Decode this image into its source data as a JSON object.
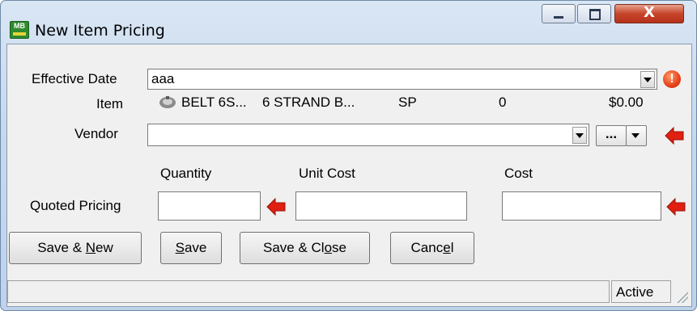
{
  "window": {
    "title": "New Item Pricing",
    "app_icon_text": "MB",
    "close_glyph": "X"
  },
  "form": {
    "effective_date": {
      "label": "Effective Date",
      "value": "aaa"
    },
    "item": {
      "label": "Item",
      "code": "BELT 6S...",
      "description": "6 STRAND B...",
      "unit": "SP",
      "quantity": "0",
      "price": "$0.00"
    },
    "vendor": {
      "label": "Vendor",
      "value": "",
      "ellipsis_label": "..."
    },
    "pricing": {
      "row_label": "Quoted Pricing",
      "quantity_header": "Quantity",
      "unit_cost_header": "Unit Cost",
      "cost_header": "Cost",
      "quantity_value": "",
      "unit_cost_value": "",
      "cost_value": ""
    }
  },
  "buttons": {
    "save_new": {
      "pre": "Save & ",
      "key": "N",
      "post": "ew"
    },
    "save": {
      "pre": "",
      "key": "S",
      "post": "ave"
    },
    "save_close": {
      "pre": "Save & Cl",
      "key": "o",
      "post": "se"
    },
    "cancel": {
      "pre": "Canc",
      "key": "e",
      "post": "l"
    }
  },
  "statusbar": {
    "status": "Active"
  },
  "icons": {
    "error": "exclamation-circle-icon",
    "arrow": "left-arrow-icon",
    "item": "gear-belt-icon"
  },
  "colors": {
    "error_red": "#e8401a",
    "arrow_red": "#e02010"
  }
}
